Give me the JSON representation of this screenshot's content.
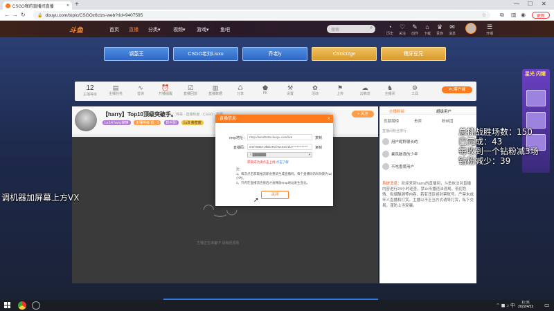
{
  "browser": {
    "tab_title": "CSGO咖的直播间直播",
    "tab_close": "×",
    "new_tab": "+",
    "url": "douyu.com/topic/CSGOz6ctzs-web?rid=9407595",
    "update_label": "更新",
    "nav": {
      "back": "←",
      "forward": "→",
      "reload": "↻",
      "home": "⌂"
    },
    "win": {
      "min": "—",
      "max": "☐",
      "close": "✕"
    }
  },
  "header": {
    "logo": "斗鱼",
    "nav": [
      "首页",
      "直播",
      "分类▾",
      "视频▾",
      "游戏▾",
      "鱼吧"
    ],
    "active_index": 1,
    "search_placeholder": "搜索",
    "icons": [
      {
        "glyph": "◔",
        "label": "历史"
      },
      {
        "glyph": "♡",
        "label": "关注"
      },
      {
        "glyph": "✎",
        "label": "创作"
      },
      {
        "glyph": "⌂",
        "label": "下载"
      },
      {
        "glyph": "♛",
        "label": "贵族"
      },
      {
        "glyph": "✉",
        "label": "消息"
      },
      {
        "glyph": "☰",
        "label": "开播"
      }
    ]
  },
  "tiles": [
    "钢盔王",
    "CSGO老刘Liuxu",
    "乔老ly",
    "CSGO2ge",
    "糯牙豆兄"
  ],
  "toolbar": {
    "level": "12",
    "level_label": "主播等级",
    "items": [
      {
        "glyph": "▤",
        "label": "主播任务"
      },
      {
        "glyph": "∿",
        "label": "音浪"
      },
      {
        "glyph": "⏰",
        "label": "开播提醒"
      },
      {
        "glyph": "☑",
        "label": "直播回放"
      },
      {
        "glyph": "▥",
        "label": "直播数据"
      },
      {
        "glyph": "♺",
        "label": "分享"
      },
      {
        "glyph": "⬟",
        "label": "PK"
      },
      {
        "glyph": "⚒",
        "label": "设置"
      },
      {
        "glyph": "✿",
        "label": "活动"
      },
      {
        "glyph": "⚑",
        "label": "上传"
      },
      {
        "glyph": "☁",
        "label": "云推流"
      },
      {
        "glyph": "♞",
        "label": "主播间"
      },
      {
        "glyph": "⚙",
        "label": "工具"
      }
    ],
    "pc_button": "PC客户端"
  },
  "video": {
    "title": "【harry】Top10顶级突破手。",
    "meta": "伟哥 · 直播热度 · CSGO · 举报",
    "tags": [
      "Lv.14 harry家族",
      "主播等级 直_ 3",
      "粉丝团",
      "Lv.8 亲密度"
    ],
    "follow": "+ 关注",
    "tip": "主播正在准备中    请稍后观看"
  },
  "rightpanel": {
    "tabs": [
      "主播粉丝",
      "超级用户"
    ],
    "sub": [
      "贡献周榜",
      "贵宾",
      "粉丝团"
    ],
    "rank_title": "直播间粉丝排行",
    "ranks": [
      "用户昵称很长的",
      "乘风破浪的少年",
      "不吃香菜用户"
    ],
    "system_label": "系统消息：",
    "chat": "欢迎来到harry的直播间，斗鱼依法对直播内容进行24小时巡查，禁止传播违法违规、低俗色情、吸烟酗酒等内容，若有违反将封禁账号。严禁未成年人直播和打赏，主播以不正当方式诱导打赏，私下交易，谨防上当受骗。"
  },
  "overlay": {
    "total": "总挑战胜场数：150",
    "done": "已完成：43",
    "rule": "每收到一个钻粉减3场",
    "reduce": "钻粉减少：39",
    "left_note": "调机器加屏幕上方VX"
  },
  "side_banner": "星光 闪耀",
  "modal": {
    "title": "直播信息",
    "close": "×",
    "rtmp_label": "rtmp地址：",
    "rtmp_value": "rtmp://sendtc3a.douyu.com/live",
    "code_label": "直播码：",
    "code_value": "9407595rrUfBbzRd?wsSecretx*************",
    "copy": "复制",
    "select_value": "▿ ▓▓▓▓▓▓",
    "warn_text": "获取成功请点击上线",
    "warn_link": "点击了解",
    "notes_title": "注：",
    "notes": [
      "1、每次点击获取推流即会重新生成直播码，每个直播码的有效期为12小时。",
      "2、只有在直播流连接后才会释放rtmp地址发生变化。"
    ],
    "button": "关闭"
  },
  "taskbar": {
    "time": "11:31",
    "date": "2022/4/22",
    "tray": "⌃ ◼ ♪ 中"
  }
}
